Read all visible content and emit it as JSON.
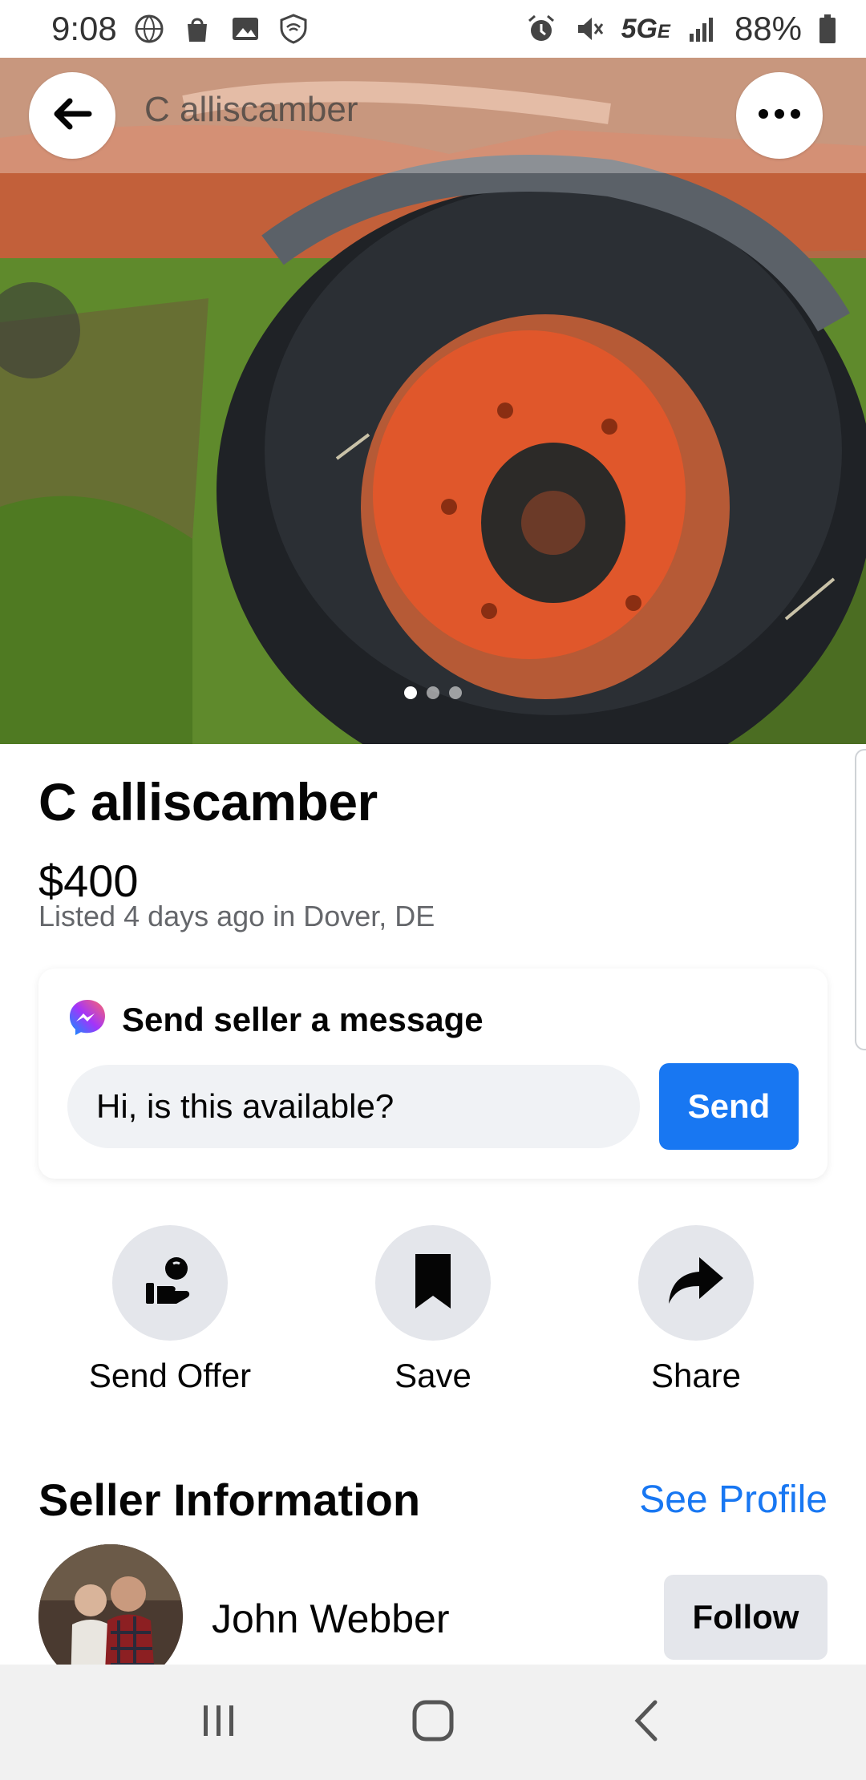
{
  "status_bar": {
    "time": "9:08",
    "network": "5G",
    "network_sub": "E",
    "battery": "88%",
    "icons_left": [
      "globe-icon",
      "bag-icon",
      "image-icon",
      "shield-wifi-icon"
    ],
    "icons_right": [
      "alarm-icon",
      "mute-icon",
      "signal-icon",
      "battery-icon"
    ]
  },
  "header": {
    "title": "C alliscamber",
    "back_icon": "arrow-left-icon",
    "more_icon": "more-horizontal-icon"
  },
  "gallery": {
    "image_count": 3,
    "active_index": 0
  },
  "listing": {
    "title": "C alliscamber",
    "price": "$400",
    "listed": "Listed 4 days ago in Dover, DE"
  },
  "message": {
    "heading": "Send seller a message",
    "input_value": "Hi, is this available?",
    "send_label": "Send"
  },
  "actions": [
    {
      "label": "Send Offer",
      "icon": "offer-hand-icon"
    },
    {
      "label": "Save",
      "icon": "bookmark-icon"
    },
    {
      "label": "Share",
      "icon": "share-arrow-icon"
    }
  ],
  "seller": {
    "heading": "Seller Information",
    "see_profile": "See Profile",
    "name": "John Webber",
    "follow_label": "Follow"
  },
  "navbar": {
    "items": [
      "recents-icon",
      "home-icon",
      "back-icon"
    ]
  },
  "colors": {
    "accent": "#1877f2",
    "action_bg": "#e4e6eb",
    "input_bg": "#f0f2f5",
    "secondary_text": "#65676b"
  }
}
